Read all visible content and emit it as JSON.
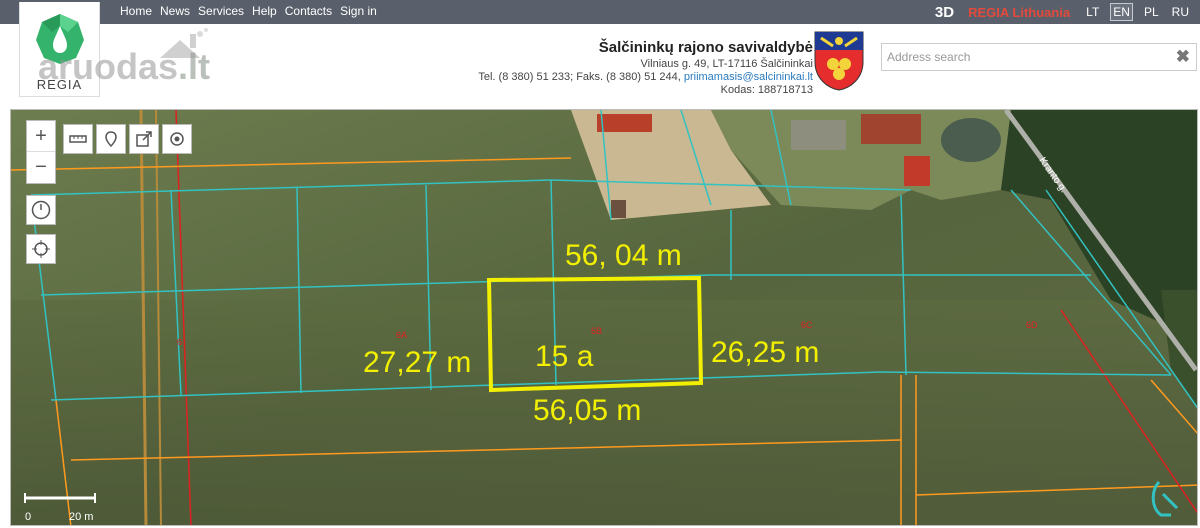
{
  "topbar": {
    "nav": [
      "Home",
      "News",
      "Services",
      "Help",
      "Contacts",
      "Sign in"
    ],
    "btn3d": "3D",
    "brand": "REGIA Lithuania",
    "languages": [
      "LT",
      "EN",
      "PL",
      "RU"
    ],
    "active_language": "EN"
  },
  "logo": {
    "text": "REGIA"
  },
  "watermark": {
    "main": "aruodas",
    "suffix": ".lt"
  },
  "municipality": {
    "name": "Šalčininkų rajono savivaldybė",
    "address": "Vilniaus g. 49, LT-17116 Šalčininkai",
    "phone": "Tel. (8 380) 51 233; Faks. (8 380) 51 244, ",
    "email": "priimamasis@salcininkai.lt",
    "code": "Kodas: 188718713"
  },
  "search": {
    "placeholder": "Address search"
  },
  "map": {
    "plot_area": "15 a",
    "dim_top": "56, 04 m",
    "dim_bottom": "56,05 m",
    "dim_left": "27,27 m",
    "dim_right": "26,25 m",
    "parcel_labels": [
      "6A",
      "6B",
      "6C",
      "6D",
      "6"
    ],
    "street_label": "Kranto g.",
    "scale_zero": "0",
    "scale_value": "20 m"
  },
  "colors": {
    "topbar": "#59606b",
    "brand": "#e4493b",
    "highlight": "#f2f000",
    "cadastre": "#33c2c2",
    "orange_line": "#ff9a1e",
    "red_line": "#e02020"
  }
}
